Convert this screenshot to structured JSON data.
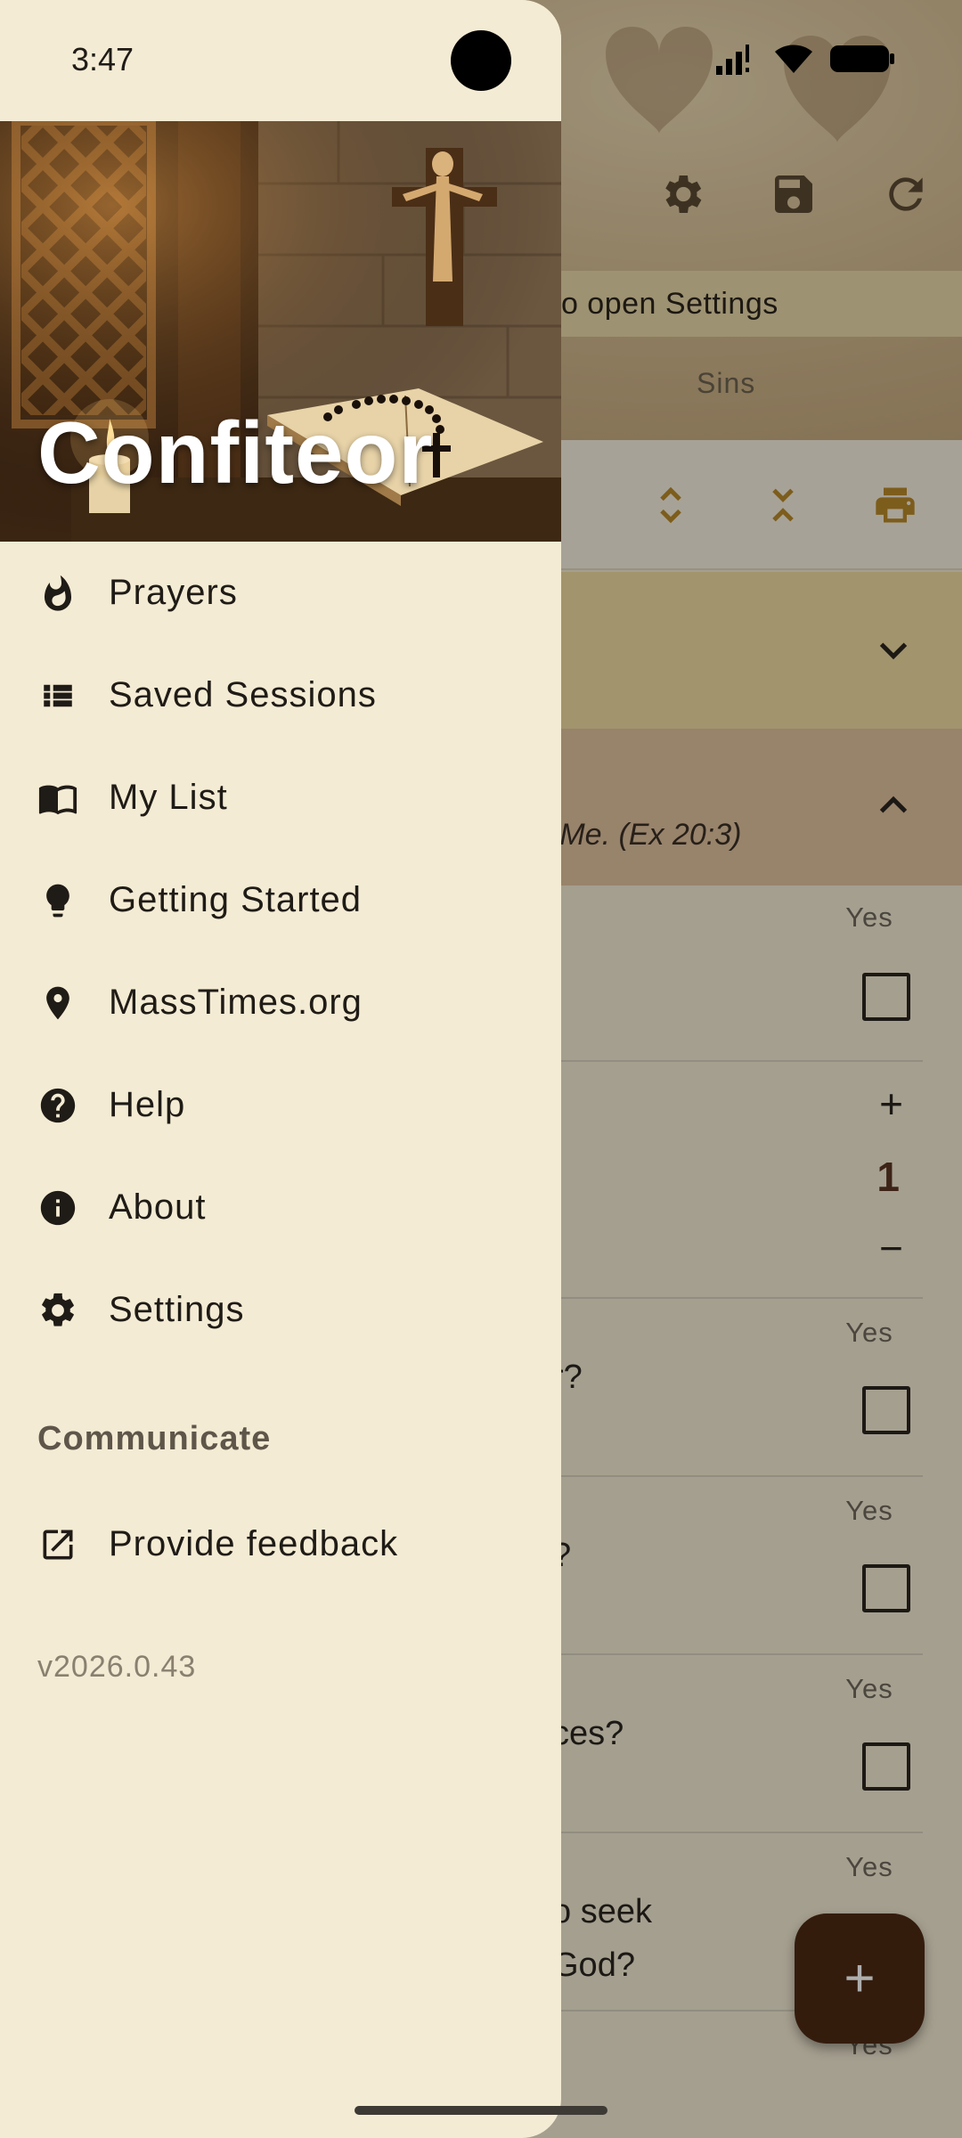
{
  "status_bar": {
    "time": "3:47"
  },
  "drawer": {
    "title": "Confiteor",
    "items": [
      {
        "label": "Prayers",
        "icon": "flame-icon"
      },
      {
        "label": "Saved Sessions",
        "icon": "list-icon"
      },
      {
        "label": "My List",
        "icon": "book-icon"
      },
      {
        "label": "Getting Started",
        "icon": "lightbulb-icon"
      },
      {
        "label": "MassTimes.org",
        "icon": "location-pin-icon"
      },
      {
        "label": "Help",
        "icon": "help-icon"
      },
      {
        "label": "About",
        "icon": "info-icon"
      },
      {
        "label": "Settings",
        "icon": "gear-icon"
      }
    ],
    "section_header": "Communicate",
    "feedback": {
      "label": "Provide feedback",
      "icon": "open-external-icon"
    },
    "version": "v2026.0.43"
  },
  "background": {
    "hint_text": "to open Settings",
    "tab_label": "Sins",
    "category_verse": "e Me. (Ex 20:3)",
    "yes_label": "Yes",
    "counter_value": "1",
    "counter_plus": "+",
    "counter_minus": "−",
    "partial_questions": [
      "r?",
      "?",
      "ces?",
      "o seek",
      "God?"
    ],
    "fab_label": "+"
  },
  "colors": {
    "drawer_bg": "#f4ebd4",
    "accent_gold": "#b8892a",
    "fab_bg": "#4d2a14",
    "text_primary": "#1f1b16"
  }
}
